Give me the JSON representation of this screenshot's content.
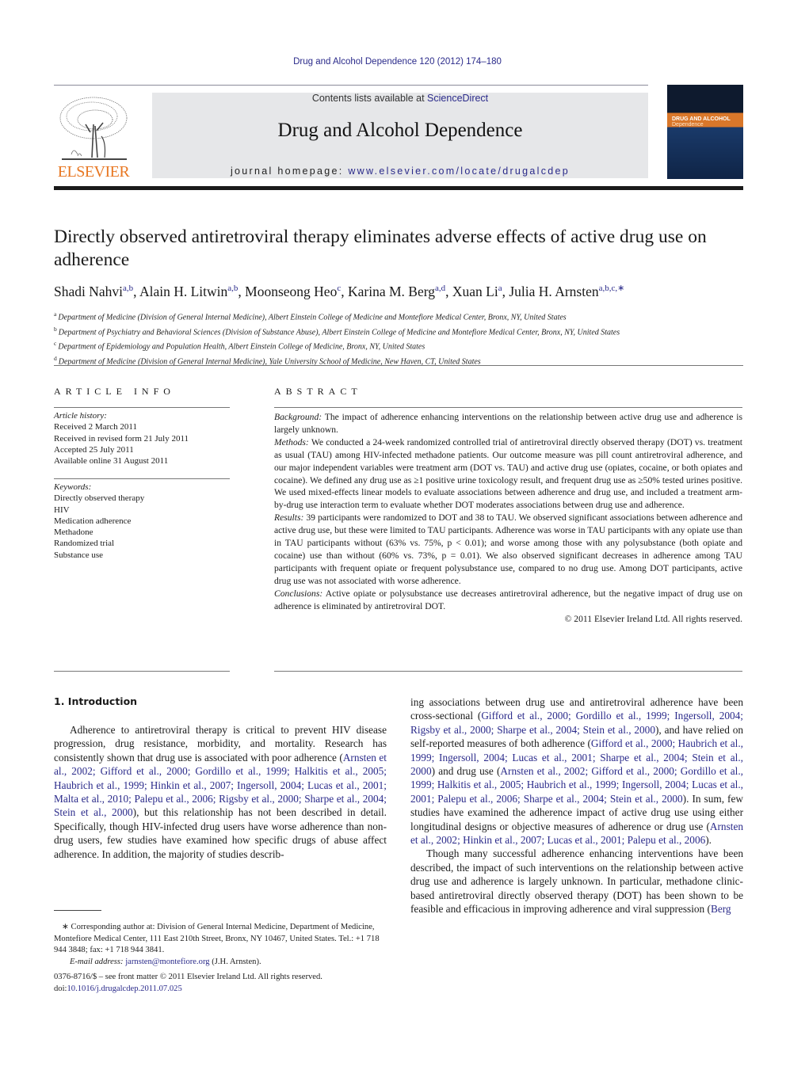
{
  "header": {
    "running_head": "Drug and Alcohol Dependence 120 (2012) 174–180",
    "contents_prefix": "Contents lists available at ",
    "contents_link": "ScienceDirect",
    "journal_title": "Drug and Alcohol Dependence",
    "homepage_prefix": "journal homepage: ",
    "homepage_url": "www.elsevier.com/locate/drugalcdep",
    "publisher_logo_text": "ELSEVIER",
    "cover_title_line1": "DRUG AND ALCOHOL",
    "cover_title_line2": "Dependence"
  },
  "article": {
    "title": "Directly observed antiretroviral therapy eliminates adverse effects of active drug use on adherence",
    "authors": [
      {
        "name": "Shadi Nahvi",
        "sup": "a,b"
      },
      {
        "name": "Alain H. Litwin",
        "sup": "a,b"
      },
      {
        "name": "Moonseong Heo",
        "sup": "c"
      },
      {
        "name": "Karina M. Berg",
        "sup": "a,d"
      },
      {
        "name": "Xuan Li",
        "sup": "a"
      },
      {
        "name": "Julia H. Arnsten",
        "sup": "a,b,c,∗"
      }
    ],
    "affiliations": [
      {
        "key": "a",
        "text": "Department of Medicine (Division of General Internal Medicine), Albert Einstein College of Medicine and Montefiore Medical Center, Bronx, NY, United States"
      },
      {
        "key": "b",
        "text": "Department of Psychiatry and Behavioral Sciences (Division of Substance Abuse), Albert Einstein College of Medicine and Montefiore Medical Center, Bronx, NY, United States"
      },
      {
        "key": "c",
        "text": "Department of Epidemiology and Population Health, Albert Einstein College of Medicine, Bronx, NY, United States"
      },
      {
        "key": "d",
        "text": "Department of Medicine (Division of General Internal Medicine), Yale University School of Medicine, New Haven, CT, United States"
      }
    ]
  },
  "article_info": {
    "heading": "ARTICLE INFO",
    "history_label": "Article history:",
    "history": [
      "Received 2 March 2011",
      "Received in revised form 21 July 2011",
      "Accepted 25 July 2011",
      "Available online 31 August 2011"
    ],
    "keywords_label": "Keywords:",
    "keywords": [
      "Directly observed therapy",
      "HIV",
      "Medication adherence",
      "Methadone",
      "Randomized trial",
      "Substance use"
    ]
  },
  "abstract": {
    "heading": "ABSTRACT",
    "background_label": "Background:",
    "background": " The impact of adherence enhancing interventions on the relationship between active drug use and adherence is largely unknown.",
    "methods_label": "Methods:",
    "methods": " We conducted a 24-week randomized controlled trial of antiretroviral directly observed therapy (DOT) vs. treatment as usual (TAU) among HIV-infected methadone patients. Our outcome measure was pill count antiretroviral adherence, and our major independent variables were treatment arm (DOT vs. TAU) and active drug use (opiates, cocaine, or both opiates and cocaine). We defined any drug use as ≥1 positive urine toxicology result, and frequent drug use as ≥50% tested urines positive. We used mixed-effects linear models to evaluate associations between adherence and drug use, and included a treatment arm-by-drug use interaction term to evaluate whether DOT moderates associations between drug use and adherence.",
    "results_label": "Results:",
    "results": " 39 participants were randomized to DOT and 38 to TAU. We observed significant associations between adherence and active drug use, but these were limited to TAU participants. Adherence was worse in TAU participants with any opiate use than in TAU participants without (63% vs. 75%, p < 0.01); and worse among those with any polysubstance (both opiate and cocaine) use than without (60% vs. 73%, p = 0.01). We also observed significant decreases in adherence among TAU participants with frequent opiate or frequent polysubstance use, compared to no drug use. Among DOT participants, active drug use was not associated with worse adherence.",
    "conclusions_label": "Conclusions:",
    "conclusions": " Active opiate or polysubstance use decreases antiretroviral adherence, but the negative impact of drug use on adherence is eliminated by antiretroviral DOT.",
    "copyright": "© 2011 Elsevier Ireland Ltd. All rights reserved."
  },
  "body": {
    "intro_heading": "1.  Introduction",
    "left_p1_a": "Adherence to antiretroviral therapy is critical to prevent HIV disease progression, drug resistance, morbidity, and mortality. Research has consistently shown that drug use is associated with poor adherence (",
    "left_p1_cite": "Arnsten et al., 2002; Gifford et al., 2000; Gordillo et al., 1999; Halkitis et al., 2005; Haubrich et al., 1999; Hinkin et al., 2007; Ingersoll, 2004; Lucas et al., 2001; Malta et al., 2010; Palepu et al., 2006; Rigsby et al., 2000; Sharpe et al., 2004; Stein et al., 2000",
    "left_p1_b": "), but this relationship has not been described in detail. Specifically, though HIV-infected drug users have worse adherence than non-drug users, few studies have examined how specific drugs of abuse affect adherence. In addition, the majority of studies describ-",
    "right_p1_a": "ing associations between drug use and antiretroviral adherence have been cross-sectional (",
    "right_p1_cite1": "Gifford et al., 2000; Gordillo et al., 1999; Ingersoll, 2004; Rigsby et al., 2000; Sharpe et al., 2004; Stein et al., 2000",
    "right_p1_b": "), and have relied on self-reported measures of both adherence (",
    "right_p1_cite2": "Gifford et al., 2000; Haubrich et al., 1999; Ingersoll, 2004; Lucas et al., 2001; Sharpe et al., 2004; Stein et al., 2000",
    "right_p1_c": ") and drug use (",
    "right_p1_cite3": "Arnsten et al., 2002; Gifford et al., 2000; Gordillo et al., 1999; Halkitis et al., 2005; Haubrich et al., 1999; Ingersoll, 2004; Lucas et al., 2001; Palepu et al., 2006; Sharpe et al., 2004; Stein et al., 2000",
    "right_p1_d": "). In sum, few studies have examined the adherence impact of active drug use using either longitudinal designs or objective measures of adherence or drug use (",
    "right_p1_cite4": "Arnsten et al., 2002; Hinkin et al., 2007; Lucas et al., 2001; Palepu et al., 2006",
    "right_p1_e": ").",
    "right_p2_a": "Though many successful adherence enhancing interventions have been described, the impact of such interventions on the relationship between active drug use and adherence is largely unknown. In particular, methadone clinic-based antiretroviral directly observed therapy (DOT) has been shown to be feasible and efficacious in improving adherence and viral suppression (",
    "right_p2_cite": "Berg"
  },
  "footnote": {
    "corresponding": "∗  Corresponding author at: Division of General Internal Medicine, Department of Medicine, Montefiore Medical Center, 111 East 210th Street, Bronx, NY 10467, United States. Tel.: +1 718 944 3848; fax: +1 718 944 3841.",
    "email_label": "E-mail address:",
    "email": "jarnsten@montefiore.org",
    "email_suffix": " (J.H. Arnsten).",
    "front_matter": "0376-8716/$ – see front matter © 2011 Elsevier Ireland Ltd. All rights reserved.",
    "doi_prefix": "doi:",
    "doi": "10.1016/j.drugalcdep.2011.07.025"
  }
}
